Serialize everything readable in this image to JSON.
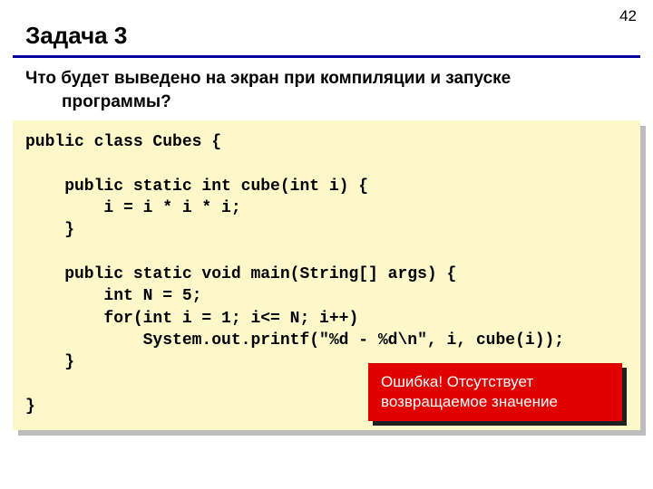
{
  "page_number": "42",
  "title": "Задача 3",
  "question_line1": "Что будет выведено на экран при компиляции и запуске",
  "question_line2": "программы?",
  "code": "public class Cubes {\n\n    public static int cube(int i) {\n        i = i * i * i;\n    }\n\n    public static void main(String[] args) {\n        int N = 5;\n        for(int i = 1; i<= N; i++)\n            System.out.printf(\"%d - %d\\n\", i, cube(i));\n    }\n\n}",
  "error_line1": "Ошибка! Отсутствует",
  "error_line2": "возвращаемое значение"
}
